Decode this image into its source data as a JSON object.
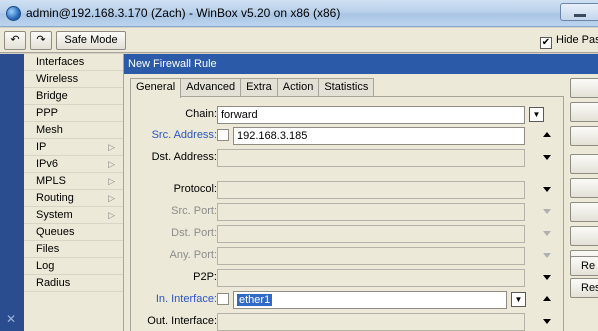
{
  "window": {
    "title": "admin@192.168.3.170 (Zach) - WinBox v5.20 on x86 (x86)"
  },
  "toolbar": {
    "undo_icon": "↶",
    "redo_icon": "↷",
    "safe_mode_label": "Safe Mode",
    "hide_passwords_label": "Hide Pass",
    "hide_passwords_checked": "✔"
  },
  "sidebar": {
    "items": [
      {
        "label": "Interfaces",
        "arrow": ""
      },
      {
        "label": "Wireless",
        "arrow": ""
      },
      {
        "label": "Bridge",
        "arrow": ""
      },
      {
        "label": "PPP",
        "arrow": ""
      },
      {
        "label": "Mesh",
        "arrow": ""
      },
      {
        "label": "IP",
        "arrow": "▷"
      },
      {
        "label": "IPv6",
        "arrow": "▷"
      },
      {
        "label": "MPLS",
        "arrow": "▷"
      },
      {
        "label": "Routing",
        "arrow": "▷"
      },
      {
        "label": "System",
        "arrow": "▷"
      },
      {
        "label": "Queues",
        "arrow": ""
      },
      {
        "label": "Files",
        "arrow": ""
      },
      {
        "label": "Log",
        "arrow": ""
      },
      {
        "label": "Radius",
        "arrow": ""
      }
    ]
  },
  "dialog": {
    "title": "New Firewall Rule",
    "tabs": [
      "General",
      "Advanced",
      "Extra",
      "Action",
      "Statistics"
    ],
    "fields": {
      "chain_label": "Chain:",
      "chain_value": "forward",
      "src_address_label": "Src. Address:",
      "src_address_value": "192.168.3.185",
      "dst_address_label": "Dst. Address:",
      "dst_address_value": "",
      "protocol_label": "Protocol:",
      "protocol_value": "",
      "src_port_label": "Src. Port:",
      "src_port_value": "",
      "dst_port_label": "Dst. Port:",
      "dst_port_value": "",
      "any_port_label": "Any. Port:",
      "any_port_value": "",
      "p2p_label": "P2P:",
      "p2p_value": "",
      "in_interface_label": "In. Interface:",
      "in_interface_value": "ether1",
      "out_interface_label": "Out. Interface:",
      "out_interface_value": ""
    },
    "side_buttons": [
      "",
      "",
      "",
      "",
      "",
      "",
      "",
      "",
      "Re",
      "Rese"
    ]
  },
  "colors": {
    "title_bar": "#b9d1ea",
    "dialog_title": "#2a5aa8",
    "sidebar_strip": "#2a4d8f",
    "link_label": "#2a54c8",
    "selection": "#316ac5"
  }
}
